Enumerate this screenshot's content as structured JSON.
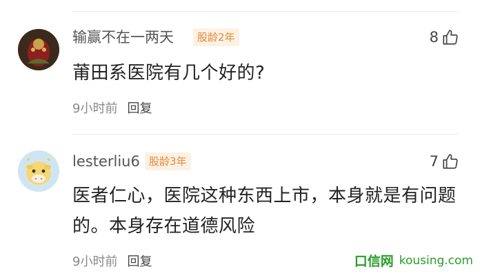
{
  "comments": [
    {
      "username": "输赢不在一两天",
      "badge": "股龄2年",
      "likes": "8",
      "text": "莆田系医院有几个好的?",
      "time": "9小时前",
      "reply_label": "回复"
    },
    {
      "username": "lesterliu6",
      "badge": "股龄3年",
      "likes": "7",
      "text": "医者仁心，医院这种东西上市，本身就是有问题的。本身存在道德风险",
      "time": "9小时前",
      "reply_label": "回复"
    }
  ],
  "watermark": {
    "logo": "口信网",
    "site": "kousing.com"
  },
  "colors": {
    "badge_bg": "#fdf1e3",
    "badge_text": "#e08a3c",
    "watermark": "#2a9d2a"
  }
}
